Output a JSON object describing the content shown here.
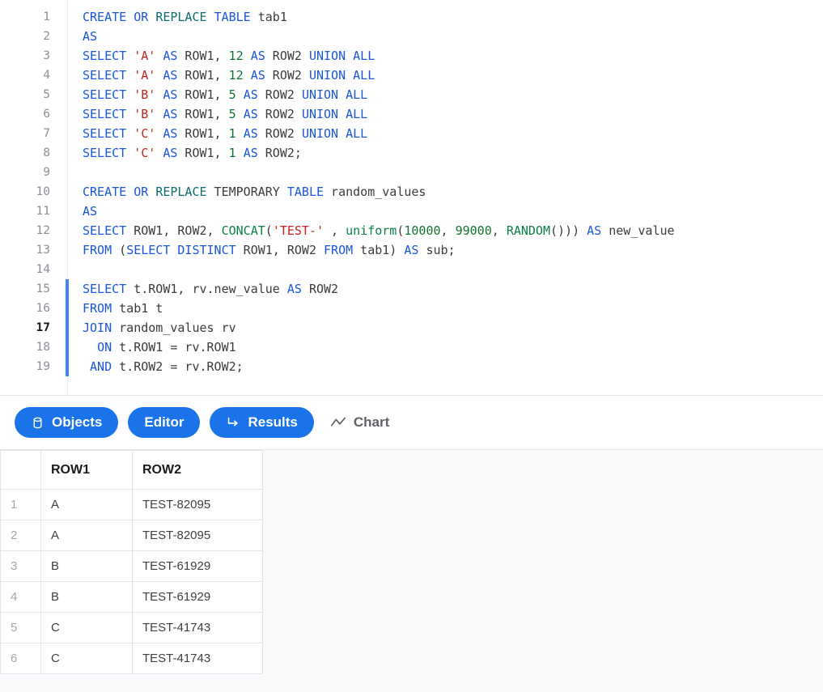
{
  "editor": {
    "current_line": 17,
    "selection_lines": [
      15,
      19
    ],
    "accent_color": "#4285f4",
    "lines": [
      {
        "n": 1,
        "tokens": [
          {
            "t": "CREATE",
            "c": "kw"
          },
          {
            "t": " ",
            "c": "pl"
          },
          {
            "t": "OR",
            "c": "kw"
          },
          {
            "t": " ",
            "c": "pl"
          },
          {
            "t": "REPLACE",
            "c": "kw2"
          },
          {
            "t": " ",
            "c": "pl"
          },
          {
            "t": "TABLE",
            "c": "kw"
          },
          {
            "t": " tab1",
            "c": "pl"
          }
        ]
      },
      {
        "n": 2,
        "tokens": [
          {
            "t": "AS",
            "c": "kw"
          }
        ]
      },
      {
        "n": 3,
        "tokens": [
          {
            "t": "SELECT",
            "c": "kw"
          },
          {
            "t": " ",
            "c": "pl"
          },
          {
            "t": "'A'",
            "c": "str"
          },
          {
            "t": " ",
            "c": "pl"
          },
          {
            "t": "AS",
            "c": "kw"
          },
          {
            "t": " ROW1, ",
            "c": "pl"
          },
          {
            "t": "12",
            "c": "num"
          },
          {
            "t": " ",
            "c": "pl"
          },
          {
            "t": "AS",
            "c": "kw"
          },
          {
            "t": " ROW2 ",
            "c": "pl"
          },
          {
            "t": "UNION",
            "c": "kw"
          },
          {
            "t": " ",
            "c": "pl"
          },
          {
            "t": "ALL",
            "c": "kw"
          }
        ]
      },
      {
        "n": 4,
        "tokens": [
          {
            "t": "SELECT",
            "c": "kw"
          },
          {
            "t": " ",
            "c": "pl"
          },
          {
            "t": "'A'",
            "c": "str"
          },
          {
            "t": " ",
            "c": "pl"
          },
          {
            "t": "AS",
            "c": "kw"
          },
          {
            "t": " ROW1, ",
            "c": "pl"
          },
          {
            "t": "12",
            "c": "num"
          },
          {
            "t": " ",
            "c": "pl"
          },
          {
            "t": "AS",
            "c": "kw"
          },
          {
            "t": " ROW2 ",
            "c": "pl"
          },
          {
            "t": "UNION",
            "c": "kw"
          },
          {
            "t": " ",
            "c": "pl"
          },
          {
            "t": "ALL",
            "c": "kw"
          }
        ]
      },
      {
        "n": 5,
        "tokens": [
          {
            "t": "SELECT",
            "c": "kw"
          },
          {
            "t": " ",
            "c": "pl"
          },
          {
            "t": "'B'",
            "c": "str"
          },
          {
            "t": " ",
            "c": "pl"
          },
          {
            "t": "AS",
            "c": "kw"
          },
          {
            "t": " ROW1, ",
            "c": "pl"
          },
          {
            "t": "5",
            "c": "num"
          },
          {
            "t": " ",
            "c": "pl"
          },
          {
            "t": "AS",
            "c": "kw"
          },
          {
            "t": " ROW2 ",
            "c": "pl"
          },
          {
            "t": "UNION",
            "c": "kw"
          },
          {
            "t": " ",
            "c": "pl"
          },
          {
            "t": "ALL",
            "c": "kw"
          }
        ]
      },
      {
        "n": 6,
        "tokens": [
          {
            "t": "SELECT",
            "c": "kw"
          },
          {
            "t": " ",
            "c": "pl"
          },
          {
            "t": "'B'",
            "c": "str"
          },
          {
            "t": " ",
            "c": "pl"
          },
          {
            "t": "AS",
            "c": "kw"
          },
          {
            "t": " ROW1, ",
            "c": "pl"
          },
          {
            "t": "5",
            "c": "num"
          },
          {
            "t": " ",
            "c": "pl"
          },
          {
            "t": "AS",
            "c": "kw"
          },
          {
            "t": " ROW2 ",
            "c": "pl"
          },
          {
            "t": "UNION",
            "c": "kw"
          },
          {
            "t": " ",
            "c": "pl"
          },
          {
            "t": "ALL",
            "c": "kw"
          }
        ]
      },
      {
        "n": 7,
        "tokens": [
          {
            "t": "SELECT",
            "c": "kw"
          },
          {
            "t": " ",
            "c": "pl"
          },
          {
            "t": "'C'",
            "c": "str"
          },
          {
            "t": " ",
            "c": "pl"
          },
          {
            "t": "AS",
            "c": "kw"
          },
          {
            "t": " ROW1, ",
            "c": "pl"
          },
          {
            "t": "1",
            "c": "num"
          },
          {
            "t": " ",
            "c": "pl"
          },
          {
            "t": "AS",
            "c": "kw"
          },
          {
            "t": " ROW2 ",
            "c": "pl"
          },
          {
            "t": "UNION",
            "c": "kw"
          },
          {
            "t": " ",
            "c": "pl"
          },
          {
            "t": "ALL",
            "c": "kw"
          }
        ]
      },
      {
        "n": 8,
        "tokens": [
          {
            "t": "SELECT",
            "c": "kw"
          },
          {
            "t": " ",
            "c": "pl"
          },
          {
            "t": "'C'",
            "c": "str"
          },
          {
            "t": " ",
            "c": "pl"
          },
          {
            "t": "AS",
            "c": "kw"
          },
          {
            "t": " ROW1, ",
            "c": "pl"
          },
          {
            "t": "1",
            "c": "num"
          },
          {
            "t": " ",
            "c": "pl"
          },
          {
            "t": "AS",
            "c": "kw"
          },
          {
            "t": " ROW2;",
            "c": "pl"
          }
        ]
      },
      {
        "n": 9,
        "tokens": []
      },
      {
        "n": 10,
        "tokens": [
          {
            "t": "CREATE",
            "c": "kw"
          },
          {
            "t": " ",
            "c": "pl"
          },
          {
            "t": "OR",
            "c": "kw"
          },
          {
            "t": " ",
            "c": "pl"
          },
          {
            "t": "REPLACE",
            "c": "kw2"
          },
          {
            "t": " TEMPORARY ",
            "c": "pl"
          },
          {
            "t": "TABLE",
            "c": "kw"
          },
          {
            "t": " random_values",
            "c": "pl"
          }
        ]
      },
      {
        "n": 11,
        "tokens": [
          {
            "t": "AS",
            "c": "kw"
          }
        ]
      },
      {
        "n": 12,
        "tokens": [
          {
            "t": "SELECT",
            "c": "kw"
          },
          {
            "t": " ROW1, ROW2, ",
            "c": "pl"
          },
          {
            "t": "CONCAT",
            "c": "fn"
          },
          {
            "t": "(",
            "c": "pl"
          },
          {
            "t": "'TEST-'",
            "c": "str"
          },
          {
            "t": " , ",
            "c": "pl"
          },
          {
            "t": "uniform",
            "c": "fn"
          },
          {
            "t": "(",
            "c": "pl"
          },
          {
            "t": "10000",
            "c": "num"
          },
          {
            "t": ", ",
            "c": "pl"
          },
          {
            "t": "99000",
            "c": "num"
          },
          {
            "t": ", ",
            "c": "pl"
          },
          {
            "t": "RANDOM",
            "c": "fn"
          },
          {
            "t": "())) ",
            "c": "pl"
          },
          {
            "t": "AS",
            "c": "kw"
          },
          {
            "t": " new_value",
            "c": "pl"
          }
        ]
      },
      {
        "n": 13,
        "tokens": [
          {
            "t": "FROM",
            "c": "kw"
          },
          {
            "t": " (",
            "c": "pl"
          },
          {
            "t": "SELECT",
            "c": "kw"
          },
          {
            "t": " ",
            "c": "pl"
          },
          {
            "t": "DISTINCT",
            "c": "kw"
          },
          {
            "t": " ROW1, ROW2 ",
            "c": "pl"
          },
          {
            "t": "FROM",
            "c": "kw"
          },
          {
            "t": " tab1) ",
            "c": "pl"
          },
          {
            "t": "AS",
            "c": "kw"
          },
          {
            "t": " sub;",
            "c": "pl"
          }
        ]
      },
      {
        "n": 14,
        "tokens": []
      },
      {
        "n": 15,
        "tokens": [
          {
            "t": "SELECT",
            "c": "kw"
          },
          {
            "t": " t.ROW1, rv.new_value ",
            "c": "pl"
          },
          {
            "t": "AS",
            "c": "kw"
          },
          {
            "t": " ROW2",
            "c": "pl"
          }
        ]
      },
      {
        "n": 16,
        "tokens": [
          {
            "t": "FROM",
            "c": "kw"
          },
          {
            "t": " tab1 t",
            "c": "pl"
          }
        ]
      },
      {
        "n": 17,
        "tokens": [
          {
            "t": "JOIN",
            "c": "kw"
          },
          {
            "t": " random_values rv",
            "c": "pl"
          }
        ]
      },
      {
        "n": 18,
        "tokens": [
          {
            "t": "  ",
            "c": "pl"
          },
          {
            "t": "ON",
            "c": "kw"
          },
          {
            "t": " t.ROW1 = rv.ROW1",
            "c": "pl"
          }
        ]
      },
      {
        "n": 19,
        "tokens": [
          {
            "t": " ",
            "c": "pl"
          },
          {
            "t": "AND",
            "c": "kw"
          },
          {
            "t": " t.ROW2 = rv.ROW2;",
            "c": "pl"
          }
        ]
      }
    ]
  },
  "tabs": [
    {
      "label": "Objects",
      "icon": "database-icon",
      "active": true
    },
    {
      "label": "Editor",
      "icon": "none",
      "active": true
    },
    {
      "label": "Results",
      "icon": "arrow-return-icon",
      "active": true
    },
    {
      "label": "Chart",
      "icon": "line-chart-icon",
      "active": false
    }
  ],
  "results_table": {
    "columns": [
      "",
      "ROW1",
      "ROW2"
    ],
    "rows": [
      {
        "idx": "1",
        "ROW1": "A",
        "ROW2": "TEST-82095"
      },
      {
        "idx": "2",
        "ROW1": "A",
        "ROW2": "TEST-82095"
      },
      {
        "idx": "3",
        "ROW1": "B",
        "ROW2": "TEST-61929"
      },
      {
        "idx": "4",
        "ROW1": "B",
        "ROW2": "TEST-61929"
      },
      {
        "idx": "5",
        "ROW1": "C",
        "ROW2": "TEST-41743"
      },
      {
        "idx": "6",
        "ROW1": "C",
        "ROW2": "TEST-41743"
      }
    ]
  },
  "colors": {
    "accent": "#1a73e8",
    "keyword": "#1a56db",
    "keyword_alt": "#0b6e6e",
    "function": "#0b8043",
    "string": "#c5221f",
    "number": "#137333",
    "results_bg": "#f8f9fa"
  }
}
